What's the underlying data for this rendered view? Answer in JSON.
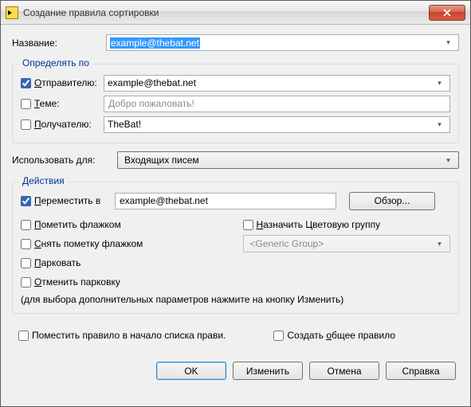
{
  "window": {
    "title": "Создание правила сортировки"
  },
  "name": {
    "label": "Название:",
    "value": "example@thebat.net"
  },
  "detect": {
    "legend": "Определять по",
    "sender": {
      "label_pre": "О",
      "label_rest": "тправителю:",
      "checked": true,
      "value": "example@thebat.net"
    },
    "subject": {
      "label_pre": "Т",
      "label_rest": "еме:",
      "checked": false,
      "placeholder": "Добро пожаловать!"
    },
    "recipient": {
      "label_pre": "П",
      "label_rest": "олучателю:",
      "checked": false,
      "value": "TheBat!"
    }
  },
  "usefor": {
    "label": "Использовать для:",
    "value": "Входящих писем"
  },
  "actions": {
    "legend": "Действия",
    "move": {
      "label_pre": "П",
      "label_rest": "ереместить в",
      "checked": true,
      "value": "example@thebat.net",
      "browse": "Обзор..."
    },
    "flag": {
      "pre": "П",
      "rest": "ометить флажком",
      "checked": false
    },
    "unflag": {
      "pre": "С",
      "rest": "нять пометку флажком",
      "checked": false
    },
    "park": {
      "pre": "П",
      "rest": "арковать",
      "checked": false
    },
    "unpark": {
      "pre": "О",
      "rest": "тменить парковку",
      "checked": false
    },
    "colorgroup_label": {
      "pre": "Н",
      "rest": "азначить Цветовую группу",
      "checked": false
    },
    "colorgroup_value": "<Generic Group>",
    "hint": "(для выбора дополнительных параметров нажмите на кнопку Изменить)"
  },
  "footer": {
    "to_top": {
      "text": "Поместить правило в начало списка прави.",
      "checked": false
    },
    "shared": {
      "pre": "о",
      "rest_before": "Создать ",
      "rest_after": "бщее правило",
      "checked": false
    }
  },
  "buttons": {
    "ok": "OK",
    "edit": "Изменить",
    "cancel": "Отмена",
    "help": "Справка"
  }
}
